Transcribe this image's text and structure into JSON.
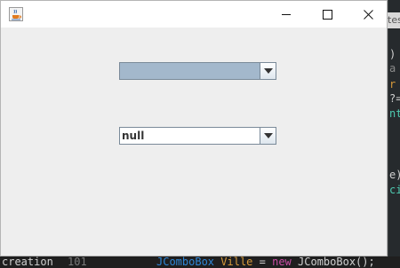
{
  "window": {
    "title": "",
    "controls": [
      "minimize",
      "maximize",
      "close"
    ]
  },
  "combo_boxes": [
    {
      "selected": ""
    },
    {
      "selected": "null"
    }
  ],
  "background_ide": {
    "tab_fragment": "tes",
    "right_code_fragments": [
      {
        "text": ")",
        "color": "#d0d0d0"
      },
      {
        "text": "a",
        "color": "#8a8a8a"
      },
      {
        "text": "r",
        "color": "#d89a3a"
      },
      {
        "text": "?=",
        "color": "#d0d0d0"
      },
      {
        "text": "nt",
        "color": "#4ec9b0"
      },
      {
        "text": "e)",
        "color": "#d0d0d0"
      },
      {
        "text": "ci",
        "color": "#4ec9b0"
      }
    ],
    "bottom_left_text": "creation",
    "bottom_line_number": "101",
    "bottom_code": {
      "type": "JComboBox",
      "var": "Ville",
      "op": "=",
      "kw": "new",
      "call": "JComboBox();"
    }
  },
  "colors": {
    "window_bg": "#eeeeee",
    "selection": "#a3b8cc",
    "ide_bg": "#2b2b2b"
  }
}
